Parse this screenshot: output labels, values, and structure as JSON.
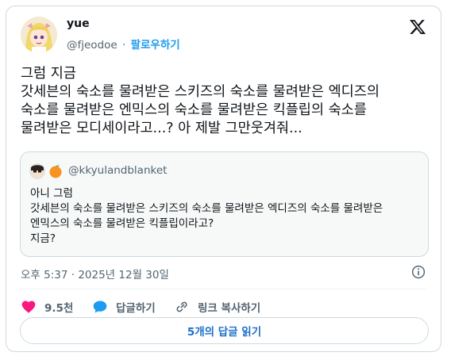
{
  "author": {
    "name": "yue",
    "handle": "@fjeodoe",
    "separator": "·",
    "follow_label": "팔로우하기",
    "avatar_icon": "anime-girl-avatar"
  },
  "brand_icon": "x-logo-icon",
  "tweet": {
    "text": "그럼 지금\n갓세븐의 숙소를 물려받은 스키즈의 숙소를 물려받은 엑디즈의\n숙소를 물려받은 엔믹스의 숙소를 물려받은 킥플립의 숙소를\n물려받은 모디세이라고...? 아 제발 그만웃겨줘..."
  },
  "quote": {
    "handle": "@kkyulandblanket",
    "text": "아니 그럼\n갓세븐의 숙소를 물려받은 스키즈의 숙소를 물려받은 엑디즈의 숙소를 물려받은\n엔믹스의 숙소를 물려받은 킥플립이라고?\n지금?"
  },
  "timestamp": "오후 5:37 · 2025년 12월 30일",
  "actions": {
    "like_count": "9.5천",
    "reply_label": "답글하기",
    "copy_link_label": "링크 복사하기"
  },
  "replies_button_label": "5개의 답글 읽기",
  "colors": {
    "like": "#f91880",
    "reply": "#1d9bf0",
    "link": "#1d6fc9",
    "border": "#cfd9de",
    "muted": "#536471"
  }
}
